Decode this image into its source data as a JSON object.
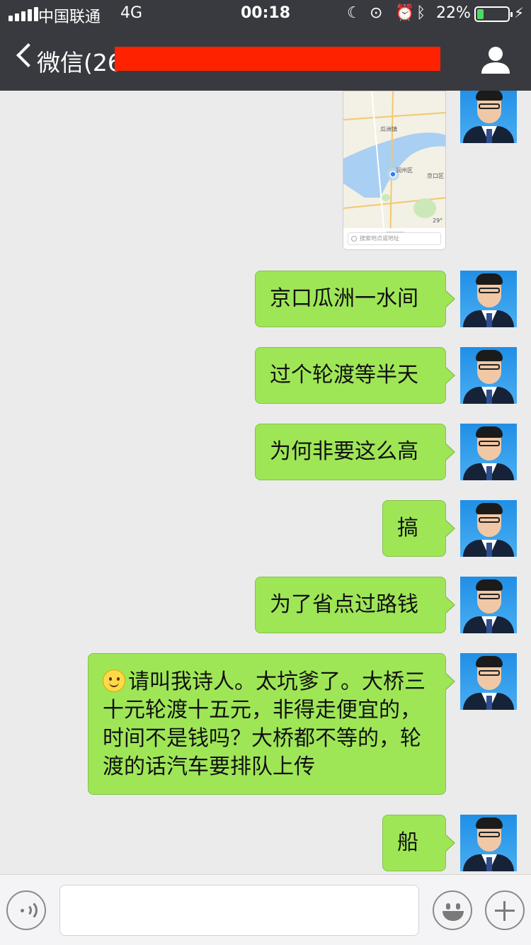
{
  "status_bar": {
    "carrier": "中国联通",
    "network": "4G",
    "time": "00:18",
    "battery_percent": "22%",
    "battery_level": 0.22,
    "icons": [
      "signal-icon",
      "moon-icon",
      "rotation-lock-icon",
      "alarm-icon",
      "bluetooth-icon",
      "battery-icon",
      "charging-icon"
    ]
  },
  "nav": {
    "back_label": "微信(26",
    "right_icon": "profile-icon"
  },
  "map_card": {
    "labels": [
      "瓜洲镇",
      "润州区",
      "京口区",
      "29°"
    ],
    "search_placeholder": "搜索地点或地址"
  },
  "messages": [
    {
      "text": "京口瓜洲一水间",
      "sender": "self"
    },
    {
      "text": "过个轮渡等半天",
      "sender": "self"
    },
    {
      "text": "为何非要这么高",
      "sender": "self"
    },
    {
      "text": "搞",
      "sender": "self"
    },
    {
      "text": "为了省点过路钱",
      "sender": "self"
    },
    {
      "text": "请叫我诗人。太坑爹了。大桥三十元轮渡十五元，非得走便宜的，时间不是钱吗？大桥都不等的，轮渡的话汽车要排队上传",
      "sender": "self",
      "emoji": "smiley-icon"
    },
    {
      "text": "船",
      "sender": "self"
    }
  ],
  "input_bar": {
    "icons": [
      "voice-icon",
      "emoji-icon",
      "plus-icon"
    ]
  },
  "colors": {
    "nav_bg": "#393a3f",
    "chat_bg": "#ebebeb",
    "bubble": "#9fe657",
    "redaction": "#ff2200"
  }
}
